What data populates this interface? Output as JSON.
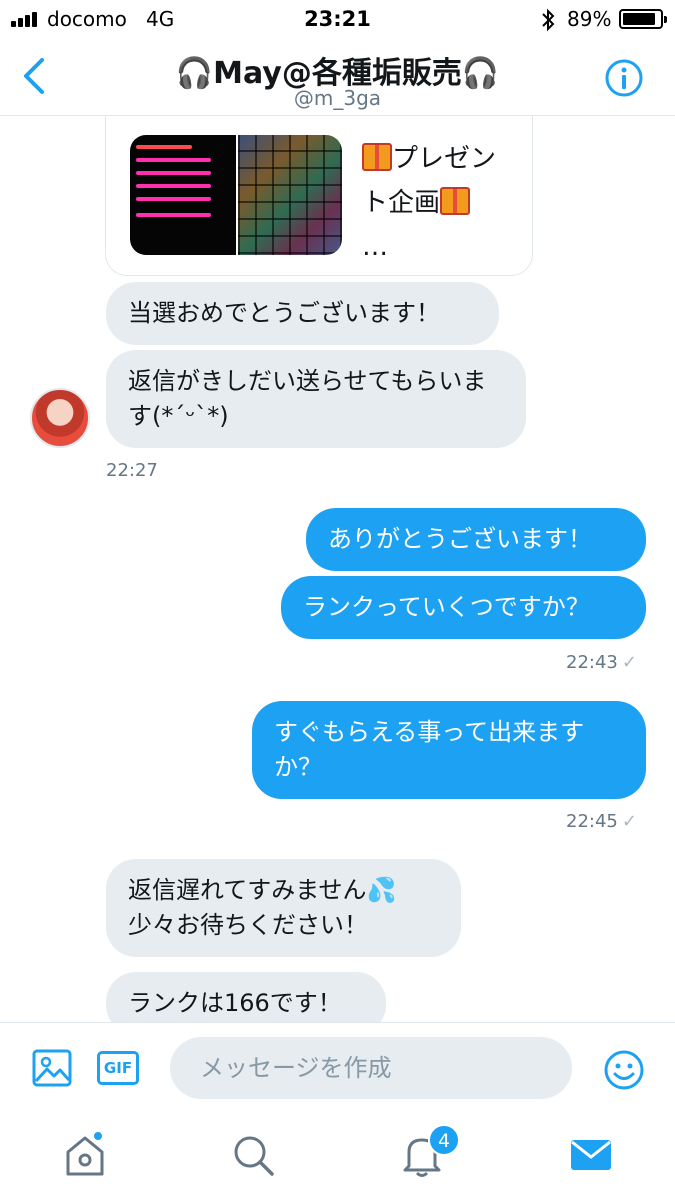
{
  "status_bar": {
    "carrier": "docomo",
    "network": "4G",
    "time": "23:21",
    "battery_percent": "89%",
    "battery_level": 0.89
  },
  "header": {
    "title": "🎧May@各種垢販売🎧",
    "handle": "@m_3ga",
    "back_icon": "chevron-left-icon",
    "info_icon": "info-icon"
  },
  "shared_card": {
    "text_line1": "プレゼン",
    "text_line2": "ト企画",
    "text_line3": "…"
  },
  "messages": [
    {
      "id": "m1",
      "direction": "received",
      "text": "当選おめでとうございます！"
    },
    {
      "id": "m2",
      "direction": "received",
      "text": "返信がきしだい送らせてもらいます(*´ᵕ`*)"
    },
    {
      "id": "t1",
      "timestamp": "22:27"
    },
    {
      "id": "m3",
      "direction": "sent",
      "text": "ありがとうございます！"
    },
    {
      "id": "m4",
      "direction": "sent",
      "text": "ランクっていくつですか？"
    },
    {
      "id": "t2",
      "timestamp": "22:43",
      "read": "✓"
    },
    {
      "id": "m5",
      "direction": "sent",
      "text": "すぐもらえる事って出来ますか？"
    },
    {
      "id": "t3",
      "timestamp": "22:45",
      "read": "✓"
    },
    {
      "id": "m6",
      "direction": "received",
      "text": "返信遅れてすみません💦\n少々お待ちください！"
    },
    {
      "id": "m7",
      "direction": "received",
      "text": "ランクは166です！"
    }
  ],
  "compose": {
    "placeholder": "メッセージを作成",
    "gif_label": "GIF"
  },
  "tabbar": {
    "notification_badge": "4"
  },
  "colors": {
    "accent": "#1da1f2",
    "received_bubble": "#e6ecf0",
    "secondary_text": "#657786"
  }
}
